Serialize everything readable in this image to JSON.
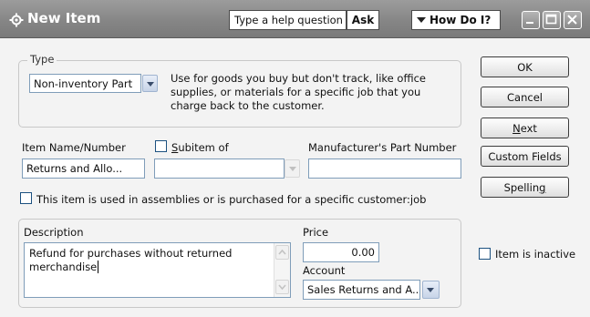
{
  "window": {
    "title": "New Item",
    "help_placeholder": "Type a help question",
    "ask_label": "Ask",
    "how_do_i_label": "How Do I?"
  },
  "type_group": {
    "label": "Type",
    "selected": "Non-inventory Part",
    "description": "Use for goods you buy but don't track, like office supplies, or materials for a specific job that you charge back to the customer."
  },
  "fields": {
    "item_name_label": "Item Name/Number",
    "item_name_value": "Returns and Allo...",
    "subitem_label": "Subitem of",
    "subitem_checked": false,
    "subitem_value": "",
    "mfr_part_label": "Manufacturer's Part Number",
    "mfr_part_value": "",
    "assemblies_label": "This item is used in assemblies or is purchased for a specific customer:job",
    "assemblies_checked": false
  },
  "purchase_group": {
    "description_label": "Description",
    "description_value": "Refund for purchases without returned merchandise",
    "price_label": "Price",
    "price_value": "0.00",
    "account_label": "Account",
    "account_value": "Sales Returns and A..."
  },
  "buttons": {
    "ok": "OK",
    "cancel": "Cancel",
    "next": "Next",
    "custom_fields": "Custom Fields",
    "spelling": "Spelling"
  },
  "inactive": {
    "label": "Item is inactive",
    "checked": false
  },
  "icons": {
    "app": "item-icon",
    "minimize": "minimize-icon",
    "maximize": "maximize-icon",
    "close": "close-icon"
  }
}
